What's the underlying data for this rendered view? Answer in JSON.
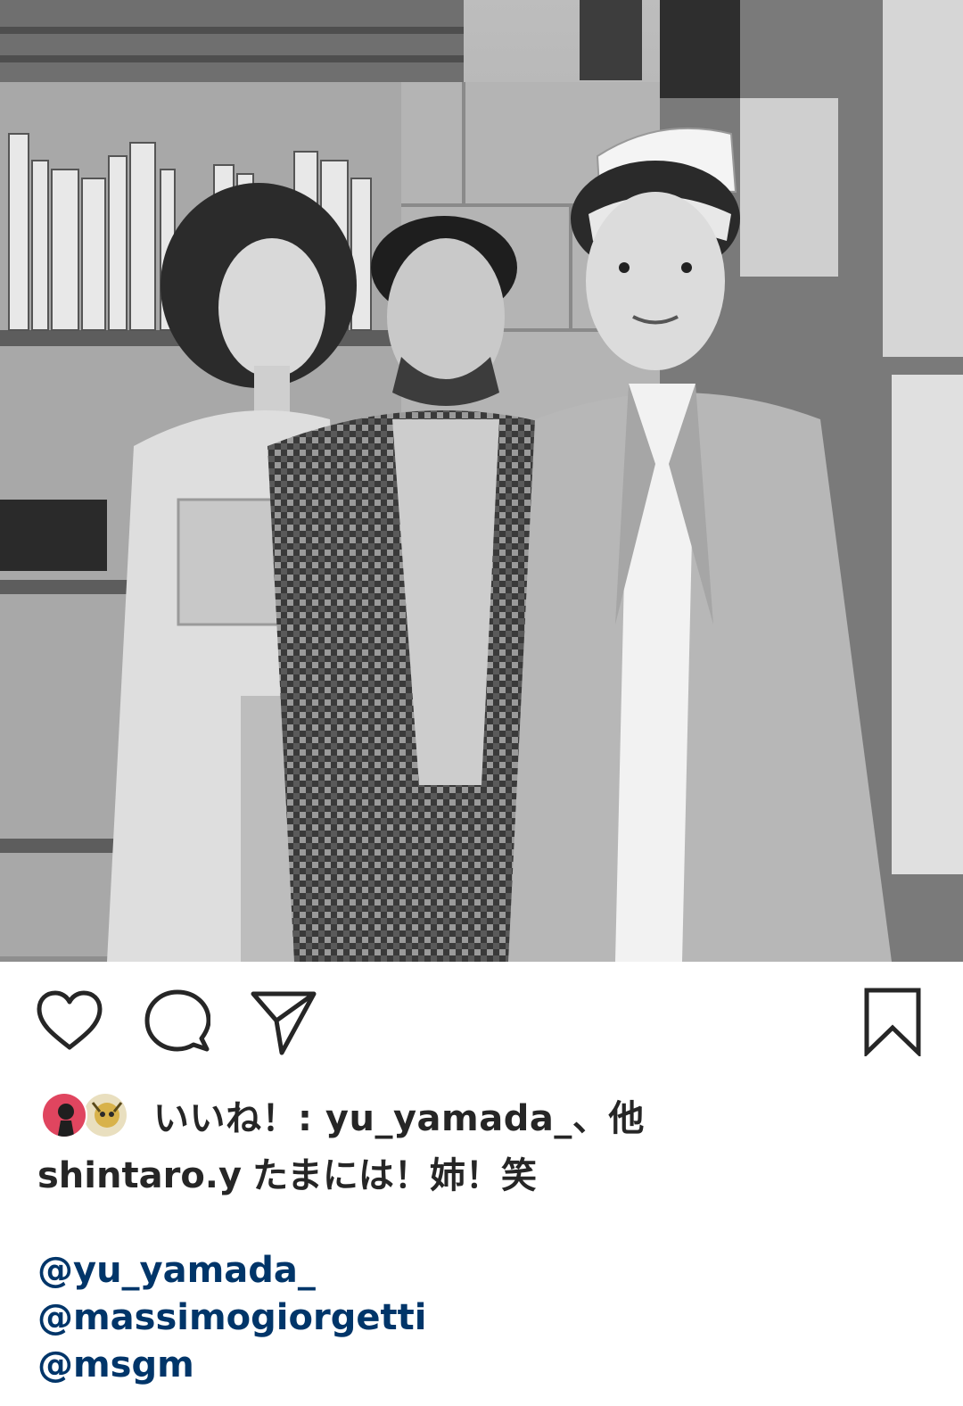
{
  "post": {
    "photo_alt": "",
    "actions": {
      "like_icon": "heart-icon",
      "comment_icon": "comment-icon",
      "share_icon": "send-icon",
      "save_icon": "bookmark-icon"
    },
    "likes": {
      "text": "いいね！: yu_yamada_、他"
    },
    "caption": {
      "username": "shintaro.y",
      "text": "たまには！姉！笑"
    },
    "mentions": [
      "@yu_yamada_",
      "@massimogiorgetti",
      "@msgm"
    ],
    "colors": {
      "text": "#262626",
      "mention": "#003569",
      "background": "#ffffff"
    }
  }
}
